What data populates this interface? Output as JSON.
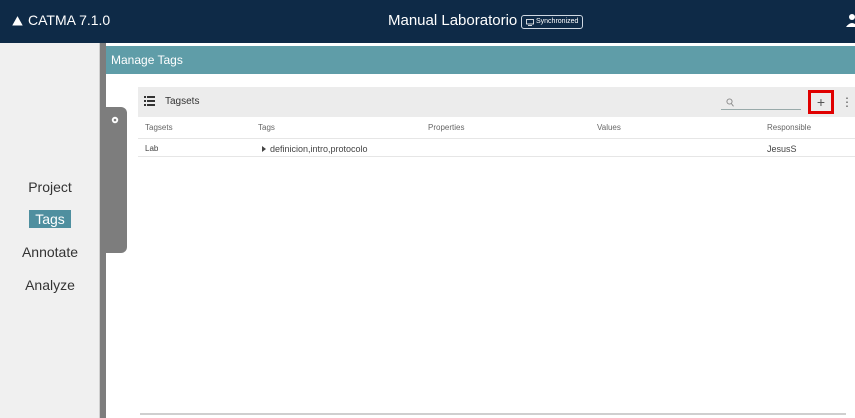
{
  "app": {
    "brand": "CATMA 7.1.0",
    "project_title": "Manual Laboratorio",
    "sync_status": "Synchronized"
  },
  "sidebar": {
    "items": [
      {
        "label": "Project",
        "active": false
      },
      {
        "label": "Tags",
        "active": true
      },
      {
        "label": "Annotate",
        "active": false
      },
      {
        "label": "Analyze",
        "active": false
      }
    ]
  },
  "main": {
    "header": "Manage Tags",
    "toolbar": {
      "title": "Tagsets",
      "search_value": "",
      "add_label": "+",
      "more_label": "⋮"
    },
    "table": {
      "columns": [
        "Tagsets",
        "Tags",
        "Properties",
        "Values",
        "Responsible"
      ],
      "rows": [
        {
          "tagset": "Lab",
          "tags": "definicion,intro,protocolo",
          "properties": "",
          "values": "",
          "responsible": "JesusS"
        }
      ]
    }
  },
  "colors": {
    "topbar": "#0e2a47",
    "accent": "#5f9da8",
    "active_nav": "#4f8f9f",
    "highlight": "#e00000"
  },
  "icons": {
    "brand": "catma-logo-icon",
    "sync": "monitor-icon",
    "user": "user-icon",
    "settings": "gear-icon",
    "list": "list-icon",
    "search": "search-icon"
  }
}
